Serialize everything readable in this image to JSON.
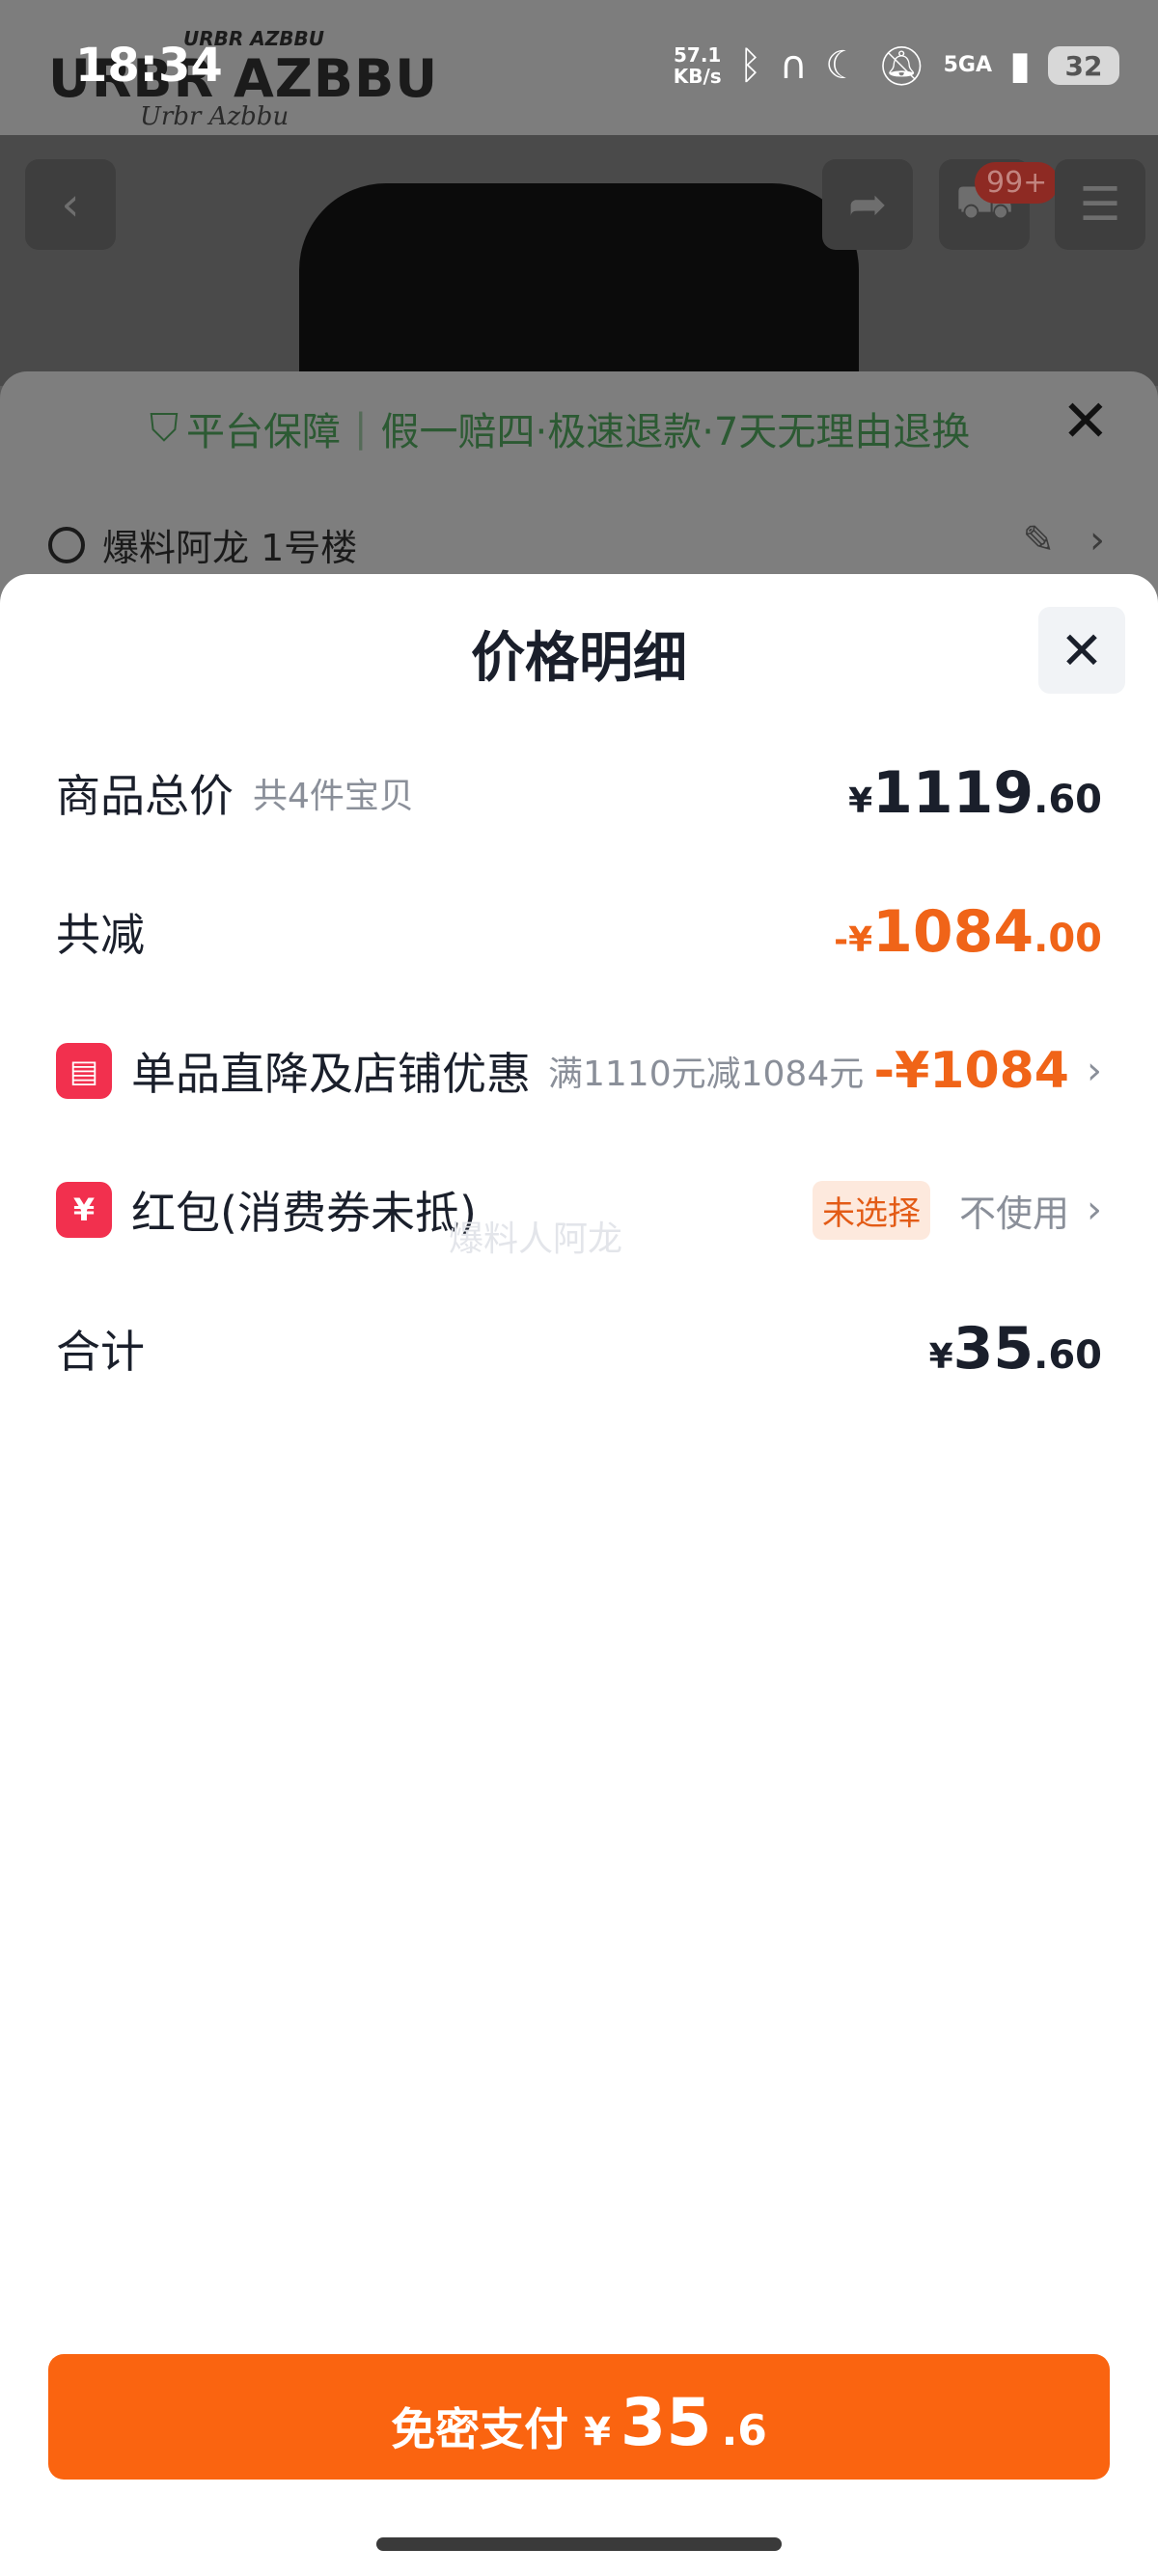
{
  "status_bar": {
    "time": "18:34",
    "net_speed_value": "57.1",
    "net_speed_unit": "KB/s",
    "network": "5GA",
    "battery": "32"
  },
  "logo_overlay": {
    "main": "URBR AZBBU",
    "top": "URBR AZBBU",
    "script": "Urbr Azbbu"
  },
  "background": {
    "cart_badge": "99+",
    "guarantee_title": "平台保障",
    "guarantee_sep": "|",
    "guarantee_items": "假一赔四·极速退款·7天无理由退换",
    "address": "爆料阿龙 1号楼"
  },
  "sheet": {
    "title": "价格明细",
    "rows": {
      "total": {
        "label": "商品总价",
        "sub": "共4件宝贝",
        "currency": "¥",
        "int": "1119",
        "dec": ".60"
      },
      "reduction": {
        "label": "共减",
        "prefix": "-¥",
        "int": "1084",
        "dec": ".00"
      },
      "discount": {
        "label": "单品直降及店铺优惠",
        "sub": "满1110元减1084元",
        "value": "-¥1084"
      },
      "redpacket": {
        "label": "红包(消费券未抵)",
        "pill": "未选择",
        "action": "不使用"
      },
      "sum": {
        "label": "合计",
        "currency": "¥",
        "int": "35",
        "dec": ".60"
      }
    },
    "watermark": "爆料人阿龙"
  },
  "pay_button": {
    "label": "免密支付",
    "currency": "¥",
    "int": "35",
    "dec": ".6"
  },
  "colors": {
    "accent_orange": "#fa6410",
    "discount_orange": "#f06418",
    "icon_red": "#f2304e"
  }
}
